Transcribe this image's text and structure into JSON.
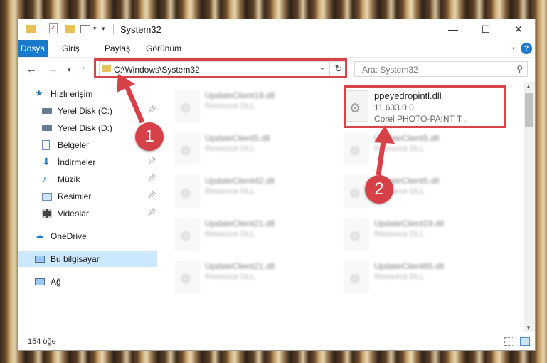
{
  "window": {
    "title": "System32"
  },
  "ribbon": {
    "tabs": [
      "Dosya",
      "Giriş",
      "Paylaş",
      "Görünüm"
    ],
    "help": "?"
  },
  "address": {
    "path": "C:\\Windows\\System32"
  },
  "search": {
    "placeholder": "Ara: System32"
  },
  "nav": {
    "quick_access": "Hızlı erişim",
    "items": [
      {
        "label": "Yerel Disk (C:)",
        "icon": "drive-icon",
        "pinned": true
      },
      {
        "label": "Yerel Disk (D:)",
        "icon": "drive-icon",
        "pinned": false
      },
      {
        "label": "Belgeler",
        "icon": "documents-icon",
        "pinned": true
      },
      {
        "label": "İndirmeler",
        "icon": "download-icon",
        "pinned": true
      },
      {
        "label": "Müzik",
        "icon": "music-icon",
        "pinned": true
      },
      {
        "label": "Resimler",
        "icon": "pictures-icon",
        "pinned": true
      },
      {
        "label": "Videolar",
        "icon": "videos-icon",
        "pinned": true
      }
    ],
    "onedrive": "OneDrive",
    "this_pc": "Bu bilgisayar",
    "network": "Ağ"
  },
  "files": {
    "highlighted": {
      "name": "ppeyedropintl.dll",
      "version": "11.633.0.0",
      "description": "Corel PHOTO-PAINT T..."
    },
    "left_column": [
      {
        "name": "UpdateClient19.dll",
        "type": "Resource DLL"
      },
      {
        "name": "UpdateClient5.dll",
        "type": "Resource DLL"
      },
      {
        "name": "UpdateClient42.dll",
        "type": "Resource DLL"
      },
      {
        "name": "UpdateClient21.dll",
        "type": "Resource DLL"
      },
      {
        "name": "UpdateClient21.dll",
        "type": "Resource DLL"
      }
    ],
    "right_column": [
      {
        "name": "UpdateClient5.dll",
        "type": "Resource DLL"
      },
      {
        "name": "UpdateClient5.dll",
        "type": "Resource DLL"
      },
      {
        "name": "UpdateClient19.dll",
        "type": "Resource DLL"
      },
      {
        "name": "UpdateClient65.dll",
        "type": "Resource DLL"
      }
    ]
  },
  "status": {
    "count": "154 öğe"
  },
  "annotations": {
    "step1": "1",
    "step2": "2",
    "color": "#d64046"
  }
}
